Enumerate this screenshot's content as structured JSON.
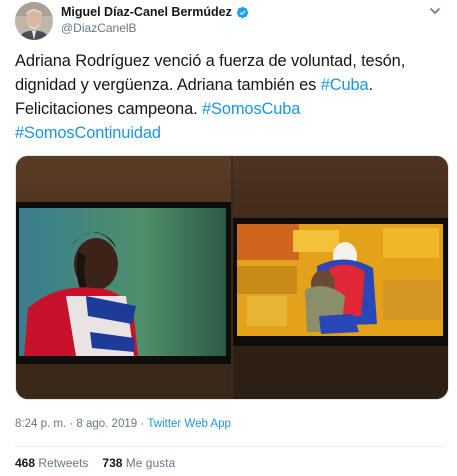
{
  "author": {
    "display_name": "Miguel Díaz-Canel Bermúdez",
    "handle": "@DiazCanelB"
  },
  "tweet": {
    "text_part1": "Adriana Rodríguez venció a fuerza de voluntad, tesón, dignidad y vergüenza. Adriana también es ",
    "hashtag_cuba": "#Cuba",
    "text_part2": ". Felicitaciones campeona. ",
    "hashtag_somoscuba": "#SomosCuba",
    "hashtag_somoscontinuidad": "#SomosContinuidad"
  },
  "meta": {
    "time": "8:24 p. m.",
    "separator": " · ",
    "date": "8 ago. 2019",
    "source": "Twitter Web App"
  },
  "stats": {
    "retweets_count": "468",
    "retweets_label": "Retweets",
    "likes_count": "738",
    "likes_label": "Me gusta"
  },
  "colors": {
    "link": "#1b95e0",
    "text": "#14171a",
    "secondary": "#657786",
    "verified": "#1da1f2"
  },
  "icons": {
    "verified": "verified-badge-icon",
    "caret": "chevron-down-icon"
  }
}
